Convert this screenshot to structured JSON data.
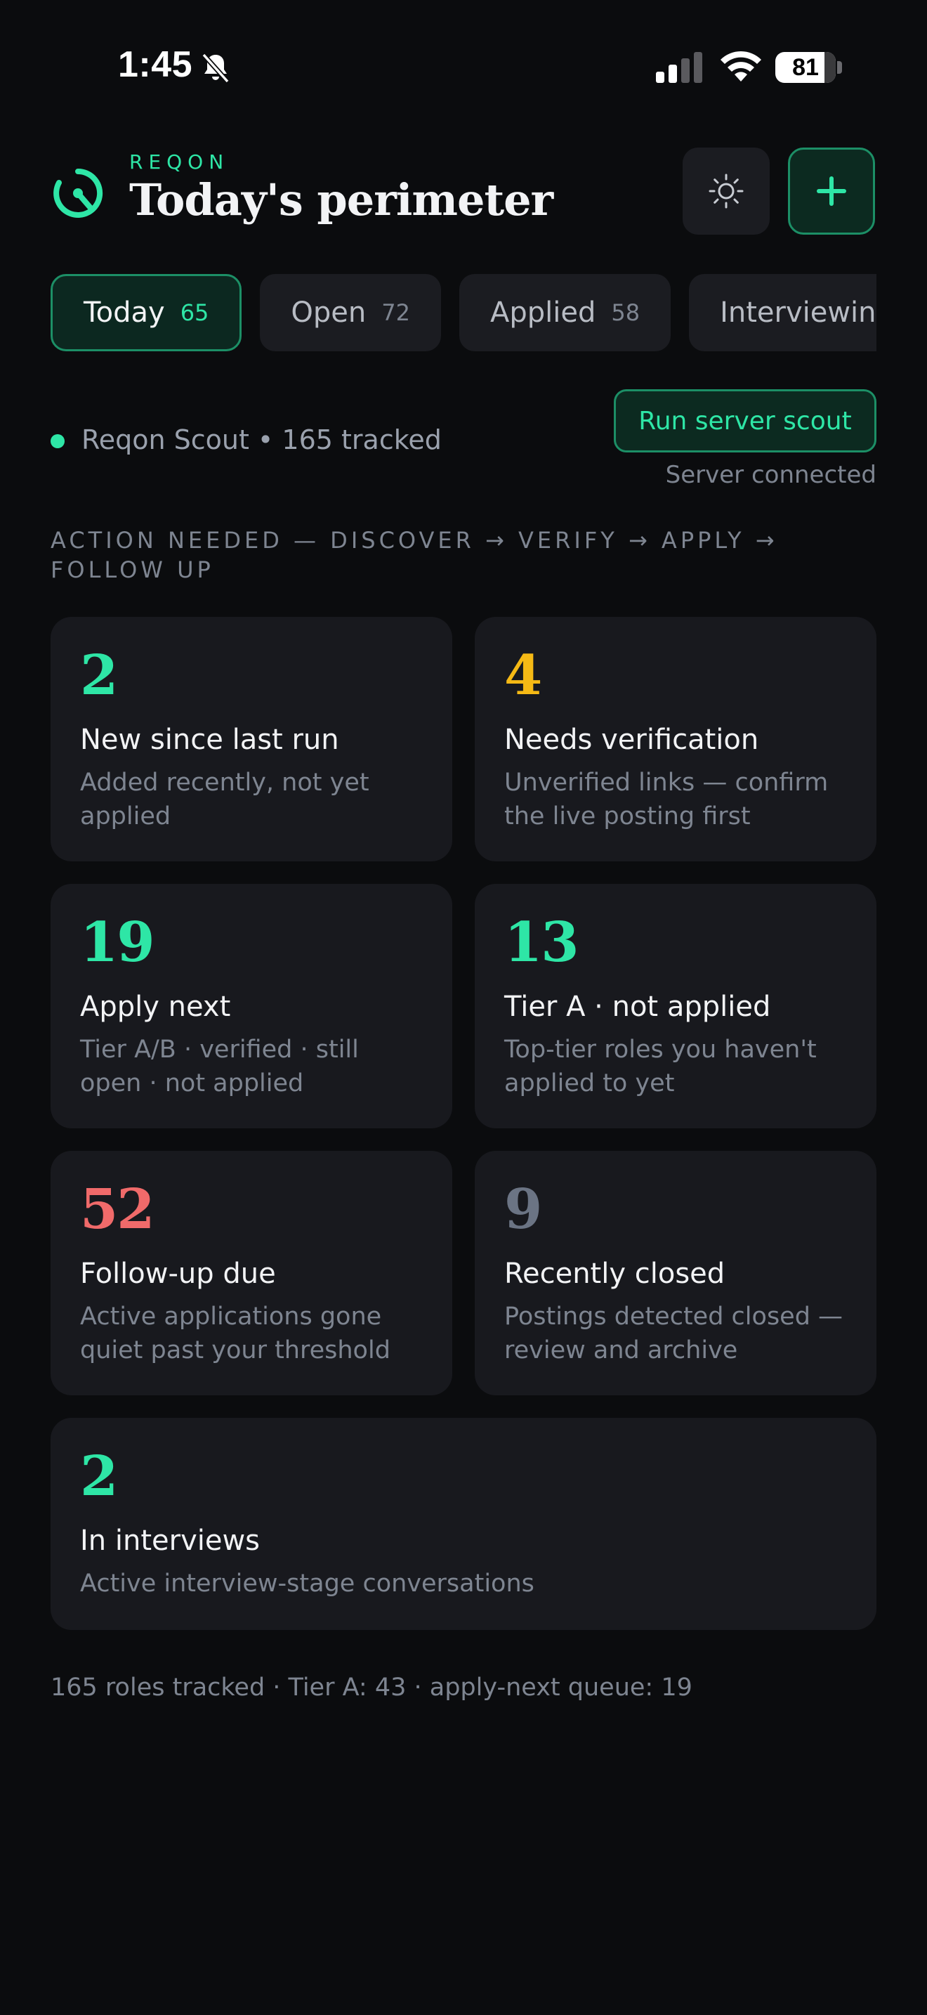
{
  "status_bar": {
    "time": "1:45",
    "battery": "81",
    "battery_fraction": 0.81
  },
  "header": {
    "brand": "REQON",
    "title": "Today's perimeter",
    "icons": {
      "logo": "radar-icon",
      "theme": "sun-icon",
      "add": "plus-icon"
    }
  },
  "tabs": [
    {
      "label": "Today",
      "count": "65"
    },
    {
      "label": "Open",
      "count": "72"
    },
    {
      "label": "Applied",
      "count": "58"
    },
    {
      "label": "Interviewing",
      "count": ""
    }
  ],
  "scout": {
    "text": "Reqon Scout • 165 tracked",
    "run_button": "Run server scout",
    "server_status": "Server connected"
  },
  "section_label": "ACTION NEEDED — DISCOVER → VERIFY → APPLY → FOLLOW UP",
  "colors": {
    "accent": "#2ee6a6",
    "warning": "#f5b915",
    "danger": "#f06a6a",
    "muted": "#6b7484"
  },
  "cards": [
    {
      "count": "2",
      "title": "New since last run",
      "desc": "Added recently, not yet applied",
      "color": "#2ee6a6"
    },
    {
      "count": "4",
      "title": "Needs verification",
      "desc": "Unverified links — confirm the live posting first",
      "color": "#f5b915"
    },
    {
      "count": "19",
      "title": "Apply next",
      "desc": "Tier A/B · verified · still open · not applied",
      "color": "#2ee6a6"
    },
    {
      "count": "13",
      "title": "Tier A · not applied",
      "desc": "Top-tier roles you haven't applied to yet",
      "color": "#2ee6a6"
    },
    {
      "count": "52",
      "title": "Follow-up due",
      "desc": "Active applications gone quiet past your threshold",
      "color": "#f06a6a"
    },
    {
      "count": "9",
      "title": "Recently closed",
      "desc": "Postings detected closed — review and archive",
      "color": "#6b7484"
    },
    {
      "count": "2",
      "title": "In interviews",
      "desc": "Active interview-stage conversations",
      "color": "#2ee6a6"
    }
  ],
  "footer": {
    "summary": "165 roles tracked · Tier A: 43 · apply-next queue: 19"
  }
}
